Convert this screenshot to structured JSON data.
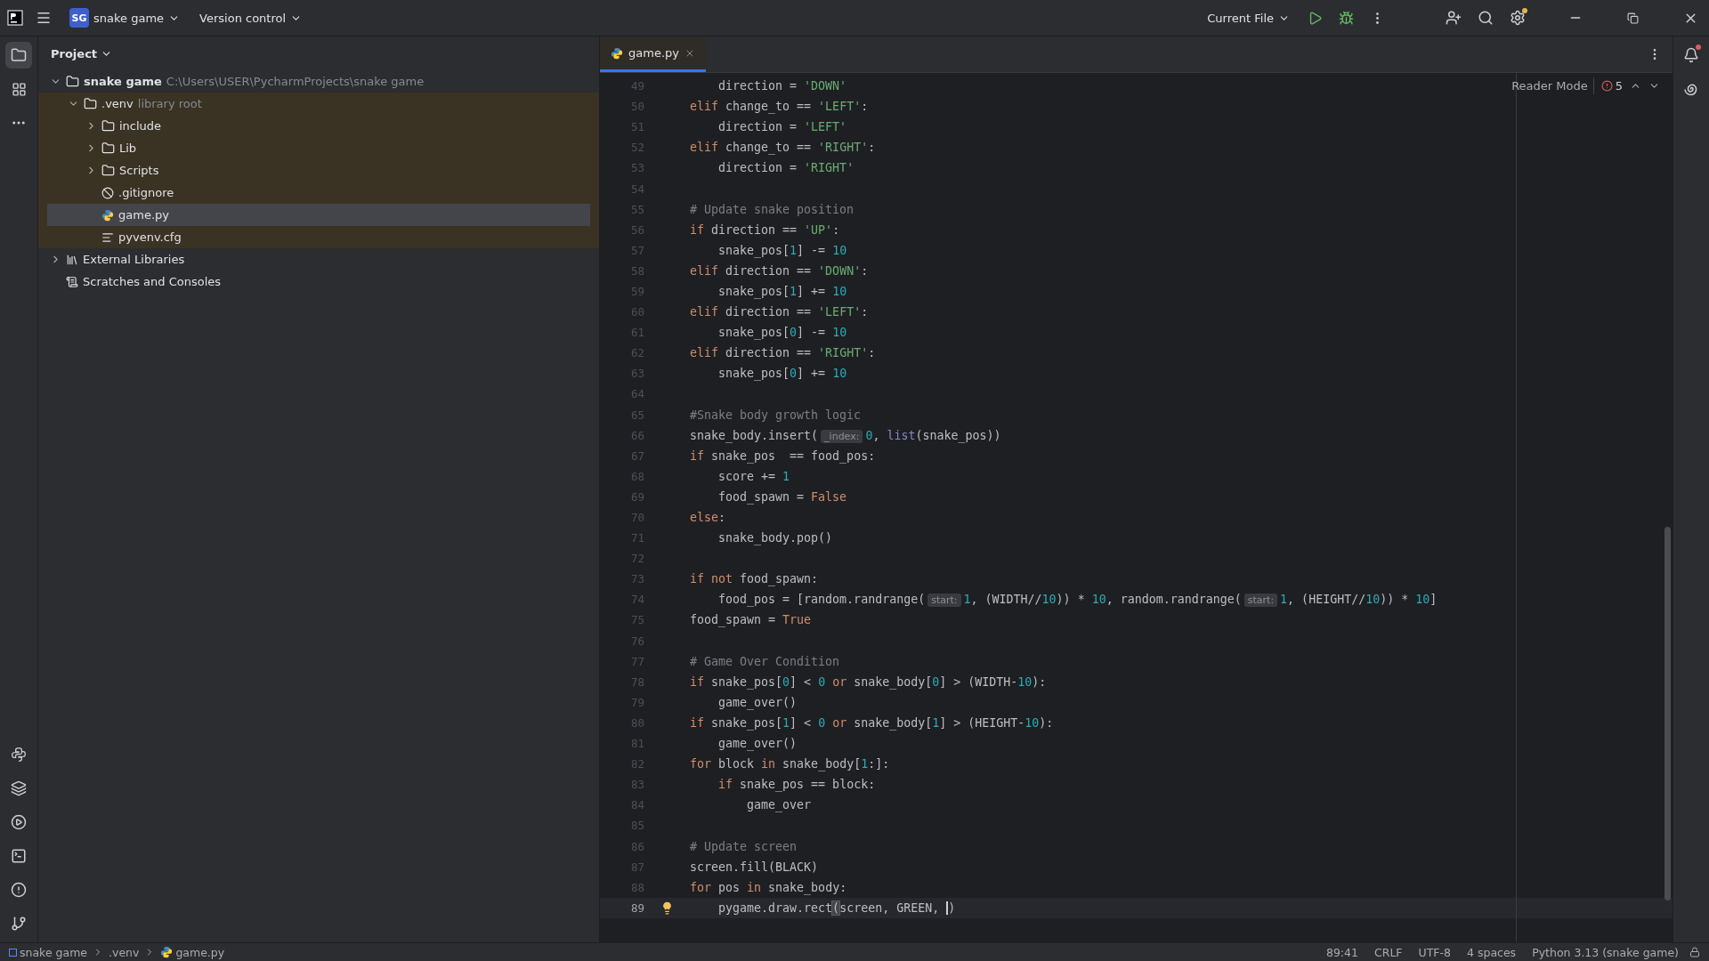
{
  "title_bar": {
    "project_badge": "SG",
    "project_name": "snake game",
    "version_control": "Version control",
    "run_config": "Current File"
  },
  "project_panel": {
    "title": "Project",
    "tree": [
      {
        "label": "snake game",
        "hint": "C:\\Users\\USER\\PycharmProjects\\snake game",
        "kind": "project",
        "expanded": true,
        "selected": false,
        "tinted": false,
        "children": [
          {
            "label": ".venv",
            "hint": "library root",
            "kind": "folder",
            "expanded": true,
            "selected": false,
            "tinted": true,
            "children": [
              {
                "label": "include",
                "kind": "folder",
                "expanded": false,
                "selected": false,
                "tinted": true
              },
              {
                "label": "Lib",
                "kind": "folder",
                "expanded": false,
                "selected": false,
                "tinted": true
              },
              {
                "label": "Scripts",
                "kind": "folder",
                "expanded": false,
                "selected": false,
                "tinted": true
              },
              {
                "label": ".gitignore",
                "kind": "ignore",
                "selected": false,
                "tinted": true
              },
              {
                "label": "game.py",
                "kind": "python",
                "selected": true,
                "tinted": true
              },
              {
                "label": "pyvenv.cfg",
                "kind": "config",
                "selected": false,
                "tinted": true
              }
            ]
          }
        ]
      },
      {
        "label": "External Libraries",
        "kind": "library",
        "expanded": false,
        "selected": false,
        "tinted": false
      },
      {
        "label": "Scratches and Consoles",
        "kind": "scratches",
        "selected": false,
        "tinted": false
      }
    ]
  },
  "editor": {
    "tabs": [
      {
        "label": "game.py",
        "selected": true
      }
    ],
    "reader_mode": "Reader Mode",
    "error_count": "5",
    "lines": [
      {
        "number": "49",
        "tokens": [
          {
            "kind": "plain",
            "t": "    direction = "
          },
          {
            "kind": "string",
            "t": "'DOWN'"
          }
        ]
      },
      {
        "number": "50",
        "tokens": [
          {
            "kind": "keyword",
            "t": "elif"
          },
          {
            "kind": "plain",
            "t": " change_to == "
          },
          {
            "kind": "string",
            "t": "'LEFT'"
          },
          {
            "kind": "plain",
            "t": ":"
          }
        ]
      },
      {
        "number": "51",
        "tokens": [
          {
            "kind": "plain",
            "t": "    direction = "
          },
          {
            "kind": "string",
            "t": "'LEFT'"
          }
        ]
      },
      {
        "number": "52",
        "tokens": [
          {
            "kind": "keyword",
            "t": "elif"
          },
          {
            "kind": "plain",
            "t": " change_to == "
          },
          {
            "kind": "string",
            "t": "'RIGHT'"
          },
          {
            "kind": "plain",
            "t": ":"
          }
        ]
      },
      {
        "number": "53",
        "tokens": [
          {
            "kind": "plain",
            "t": "    direction = "
          },
          {
            "kind": "string",
            "t": "'RIGHT'"
          }
        ]
      },
      {
        "number": "54"
      },
      {
        "number": "55",
        "tokens": [
          {
            "kind": "comment",
            "t": "# Update snake position"
          }
        ]
      },
      {
        "number": "56",
        "tokens": [
          {
            "kind": "keyword",
            "t": "if"
          },
          {
            "kind": "plain",
            "t": " direction == "
          },
          {
            "kind": "string",
            "t": "'UP'"
          },
          {
            "kind": "plain",
            "t": ":"
          }
        ]
      },
      {
        "number": "57",
        "tokens": [
          {
            "kind": "plain",
            "t": "    snake_pos["
          },
          {
            "kind": "number",
            "t": "1"
          },
          {
            "kind": "plain",
            "t": "] -= "
          },
          {
            "kind": "number",
            "t": "10"
          }
        ]
      },
      {
        "number": "58",
        "tokens": [
          {
            "kind": "keyword",
            "t": "elif"
          },
          {
            "kind": "plain",
            "t": " direction == "
          },
          {
            "kind": "string",
            "t": "'DOWN'"
          },
          {
            "kind": "plain",
            "t": ":"
          }
        ]
      },
      {
        "number": "59",
        "tokens": [
          {
            "kind": "plain",
            "t": "    snake_pos["
          },
          {
            "kind": "number",
            "t": "1"
          },
          {
            "kind": "plain",
            "t": "] += "
          },
          {
            "kind": "number",
            "t": "10"
          }
        ]
      },
      {
        "number": "60",
        "tokens": [
          {
            "kind": "keyword",
            "t": "elif"
          },
          {
            "kind": "plain",
            "t": " direction == "
          },
          {
            "kind": "string",
            "t": "'LEFT'"
          },
          {
            "kind": "plain",
            "t": ":"
          }
        ]
      },
      {
        "number": "61",
        "tokens": [
          {
            "kind": "plain",
            "t": "    snake_pos["
          },
          {
            "kind": "number",
            "t": "0"
          },
          {
            "kind": "plain",
            "t": "] -= "
          },
          {
            "kind": "number",
            "t": "10"
          }
        ]
      },
      {
        "number": "62",
        "tokens": [
          {
            "kind": "keyword",
            "t": "elif"
          },
          {
            "kind": "plain",
            "t": " direction == "
          },
          {
            "kind": "string",
            "t": "'RIGHT'"
          },
          {
            "kind": "plain",
            "t": ":"
          }
        ]
      },
      {
        "number": "63",
        "tokens": [
          {
            "kind": "plain",
            "t": "    snake_pos["
          },
          {
            "kind": "number",
            "t": "0"
          },
          {
            "kind": "plain",
            "t": "] += "
          },
          {
            "kind": "number",
            "t": "10"
          }
        ]
      },
      {
        "number": "64"
      },
      {
        "number": "65",
        "tokens": [
          {
            "kind": "comment",
            "t": "#Snake body growth logic"
          }
        ]
      },
      {
        "number": "66",
        "tokens": [
          {
            "kind": "plain",
            "t": "snake_body.insert("
          },
          {
            "kind": "hint",
            "t": "_index:"
          },
          {
            "kind": "number",
            "t": "0"
          },
          {
            "kind": "plain",
            "t": ", "
          },
          {
            "kind": "builtin",
            "t": "list"
          },
          {
            "kind": "plain",
            "t": "(snake_pos))"
          }
        ]
      },
      {
        "number": "67",
        "tokens": [
          {
            "kind": "keyword",
            "t": "if"
          },
          {
            "kind": "plain",
            "t": " snake_pos  == food_pos:"
          }
        ]
      },
      {
        "number": "68",
        "tokens": [
          {
            "kind": "plain",
            "t": "    score += "
          },
          {
            "kind": "number",
            "t": "1"
          }
        ]
      },
      {
        "number": "69",
        "tokens": [
          {
            "kind": "plain",
            "t": "    food_spawn = "
          },
          {
            "kind": "keyword",
            "t": "False"
          }
        ]
      },
      {
        "number": "70",
        "tokens": [
          {
            "kind": "keyword",
            "t": "else"
          },
          {
            "kind": "plain",
            "t": ":"
          }
        ]
      },
      {
        "number": "71",
        "tokens": [
          {
            "kind": "plain",
            "t": "    snake_body.pop()"
          }
        ]
      },
      {
        "number": "72"
      },
      {
        "number": "73",
        "tokens": [
          {
            "kind": "keyword",
            "t": "if not"
          },
          {
            "kind": "plain",
            "t": " food_spawn:"
          }
        ]
      },
      {
        "number": "74",
        "tokens": [
          {
            "kind": "plain",
            "t": "    food_pos = [random.randrange("
          },
          {
            "kind": "hint",
            "t": "start:"
          },
          {
            "kind": "number",
            "t": "1"
          },
          {
            "kind": "plain",
            "t": ", (WIDTH//"
          },
          {
            "kind": "number",
            "t": "10"
          },
          {
            "kind": "plain",
            "t": ")) * "
          },
          {
            "kind": "number",
            "t": "10"
          },
          {
            "kind": "plain",
            "t": ", random.randrange("
          },
          {
            "kind": "hint",
            "t": "start:"
          },
          {
            "kind": "number",
            "t": "1"
          },
          {
            "kind": "plain",
            "t": ", (HEIGHT//"
          },
          {
            "kind": "number",
            "t": "10"
          },
          {
            "kind": "plain",
            "t": ")) * "
          },
          {
            "kind": "number",
            "t": "10"
          },
          {
            "kind": "plain",
            "t": "]"
          }
        ]
      },
      {
        "number": "75",
        "tokens": [
          {
            "kind": "plain",
            "t": "food_spawn = "
          },
          {
            "kind": "keyword",
            "t": "True"
          }
        ]
      },
      {
        "number": "76"
      },
      {
        "number": "77",
        "tokens": [
          {
            "kind": "comment",
            "t": "# Game Over Condition"
          }
        ]
      },
      {
        "number": "78",
        "tokens": [
          {
            "kind": "keyword",
            "t": "if"
          },
          {
            "kind": "plain",
            "t": " snake_pos["
          },
          {
            "kind": "number",
            "t": "0"
          },
          {
            "kind": "plain",
            "t": "] < "
          },
          {
            "kind": "number",
            "t": "0"
          },
          {
            "kind": "keyword",
            "t": " or"
          },
          {
            "kind": "plain",
            "t": " snake_body["
          },
          {
            "kind": "number",
            "t": "0"
          },
          {
            "kind": "plain",
            "t": "] > (WIDTH-"
          },
          {
            "kind": "number",
            "t": "10"
          },
          {
            "kind": "plain",
            "t": "):"
          }
        ]
      },
      {
        "number": "79",
        "tokens": [
          {
            "kind": "plain",
            "t": "    game_over()"
          }
        ]
      },
      {
        "number": "80",
        "tokens": [
          {
            "kind": "keyword",
            "t": "if"
          },
          {
            "kind": "plain",
            "t": " snake_pos["
          },
          {
            "kind": "number",
            "t": "1"
          },
          {
            "kind": "plain",
            "t": "] < "
          },
          {
            "kind": "number",
            "t": "0"
          },
          {
            "kind": "keyword",
            "t": " or"
          },
          {
            "kind": "plain",
            "t": " snake_body["
          },
          {
            "kind": "number",
            "t": "1"
          },
          {
            "kind": "plain",
            "t": "] > (HEIGHT-"
          },
          {
            "kind": "number",
            "t": "10"
          },
          {
            "kind": "plain",
            "t": "):"
          }
        ]
      },
      {
        "number": "81",
        "tokens": [
          {
            "kind": "plain",
            "t": "    game_over()"
          }
        ]
      },
      {
        "number": "82",
        "tokens": [
          {
            "kind": "keyword",
            "t": "for"
          },
          {
            "kind": "plain",
            "t": " block "
          },
          {
            "kind": "keyword",
            "t": "in"
          },
          {
            "kind": "plain",
            "t": " snake_body["
          },
          {
            "kind": "number",
            "t": "1"
          },
          {
            "kind": "plain",
            "t": ":]:"
          }
        ]
      },
      {
        "number": "83",
        "tokens": [
          {
            "kind": "keyword",
            "t": "    if"
          },
          {
            "kind": "plain",
            "t": " snake_pos == block:"
          }
        ]
      },
      {
        "number": "84",
        "tokens": [
          {
            "kind": "plain",
            "t": "        game_over"
          }
        ]
      },
      {
        "number": "85"
      },
      {
        "number": "86",
        "tokens": [
          {
            "kind": "comment",
            "t": "# Update screen"
          }
        ]
      },
      {
        "number": "87",
        "tokens": [
          {
            "kind": "plain",
            "t": "screen.fill(BLACK)"
          }
        ]
      },
      {
        "number": "88",
        "tokens": [
          {
            "kind": "keyword",
            "t": "for"
          },
          {
            "kind": "plain",
            "t": " pos "
          },
          {
            "kind": "keyword",
            "t": "in"
          },
          {
            "kind": "plain",
            "t": " snake_body:"
          }
        ]
      },
      {
        "number": "89",
        "current": true,
        "tokens": [
          {
            "kind": "plain",
            "t": "    pygame.draw.rect"
          },
          {
            "kind": "bracket",
            "t": "("
          },
          {
            "kind": "plain",
            "t": "screen, GREEN, "
          },
          {
            "kind": "caret",
            "t": ")"
          }
        ]
      }
    ]
  },
  "status_bar": {
    "breadcrumbs": [
      {
        "label": "snake game",
        "kind": "project"
      },
      {
        "label": ".venv",
        "kind": "folder"
      },
      {
        "label": "game.py",
        "kind": "python"
      }
    ],
    "items": [
      "89:41",
      "CRLF",
      "UTF-8",
      "4 spaces",
      "Python 3.13 (snake game)"
    ]
  }
}
